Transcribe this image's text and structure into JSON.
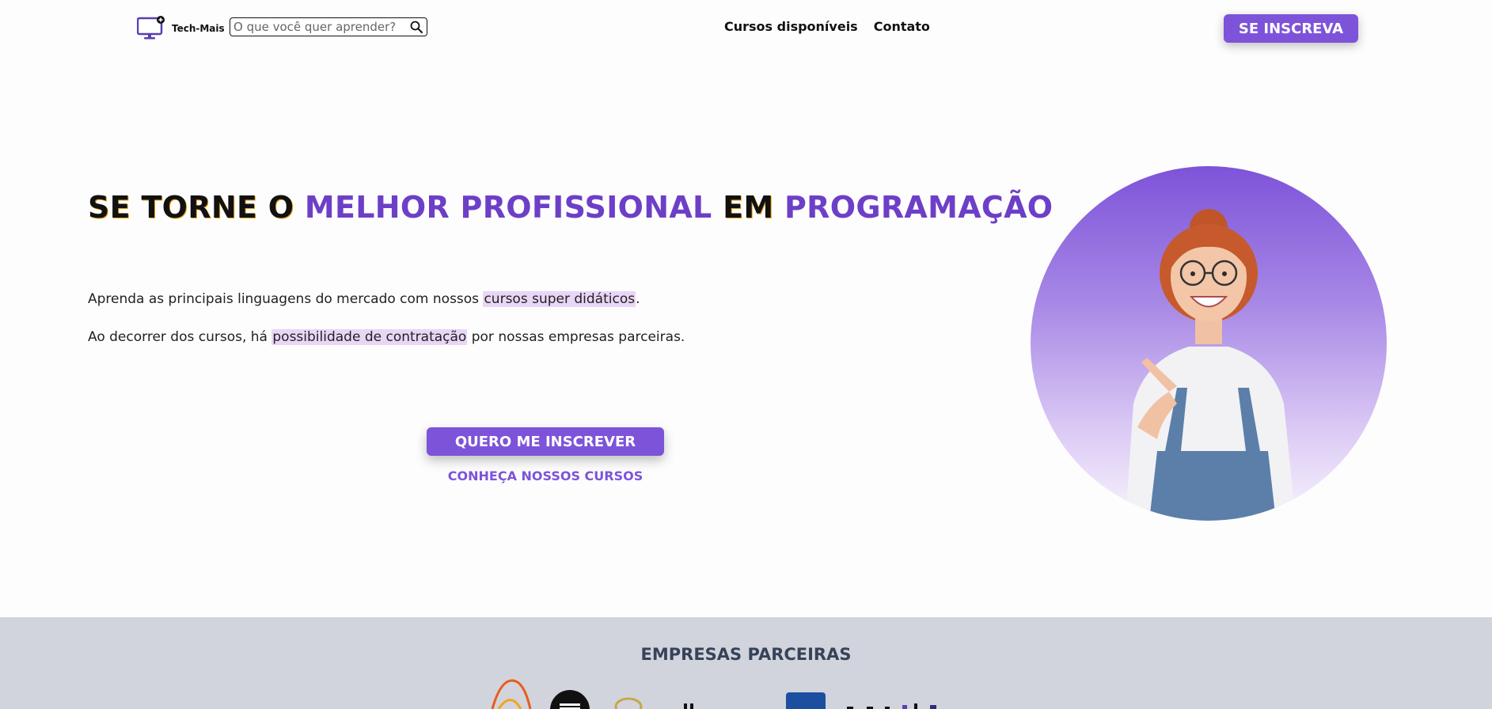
{
  "brand": {
    "name": "Tech-Mais",
    "accent": "#7d53d9",
    "heading_purple": "#6d3fc7",
    "highlight": "#e9d6f7"
  },
  "search": {
    "placeholder": "O que você quer aprender?",
    "icon": "search-icon"
  },
  "nav": {
    "items": [
      {
        "label": "Cursos disponíveis"
      },
      {
        "label": "Contato"
      }
    ]
  },
  "header_cta": {
    "label": "SE INSCREVA"
  },
  "hero": {
    "title_parts": [
      {
        "text": "SE TORNE O ",
        "style": "dark"
      },
      {
        "text": "MELHOR PROFISSIONAL",
        "style": "purple"
      },
      {
        "text": " EM ",
        "style": "dark"
      },
      {
        "text": "PROGRAMAÇÃO",
        "style": "purple"
      }
    ],
    "paragraph1": {
      "before": "Aprenda as principais linguagens do mercado com nossos ",
      "highlight": "cursos super didáticos",
      "after": "."
    },
    "paragraph2": {
      "before": "Ao decorrer dos cursos, há ",
      "highlight": "possibilidade de contratação",
      "after": " por nossas empresas parceiras."
    },
    "primary_button": "QUERO ME INSCREVER",
    "secondary_link": "CONHEÇA NOSSOS CURSOS",
    "image_subject": "smiling woman with glasses pointing"
  },
  "partners": {
    "title": "EMPRESAS PARCEIRAS",
    "partners_bg": "#d1d4dc"
  }
}
